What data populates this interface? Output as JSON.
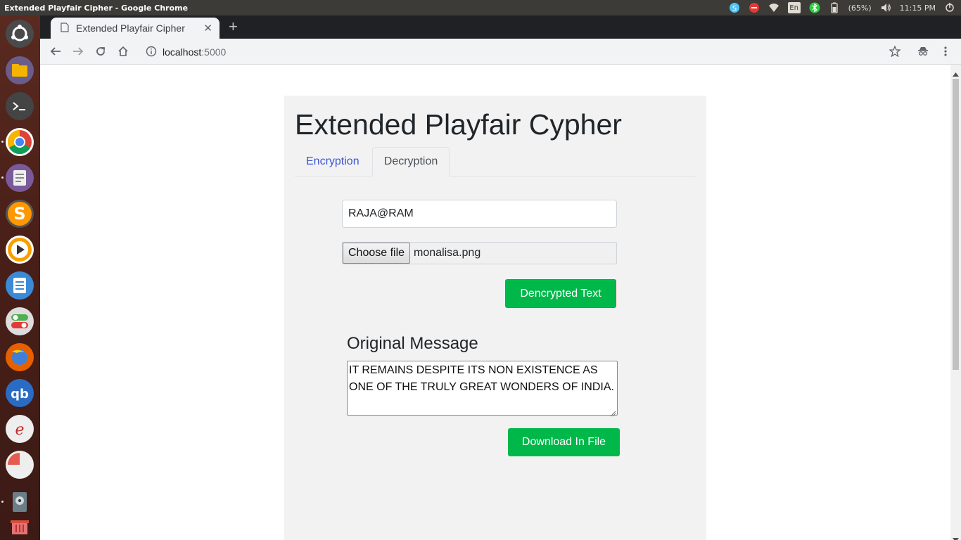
{
  "window": {
    "title": "Extended Playfair Cipher - Google Chrome"
  },
  "tray": {
    "keyboard": "En",
    "battery": "(65%)",
    "time": "11:15 PM"
  },
  "browser": {
    "tab_title": "Extended Playfair Cipher",
    "url_host": "localhost",
    "url_port": ":5000"
  },
  "page": {
    "heading": "Extended Playfair Cypher",
    "tabs": [
      {
        "label": "Encryption",
        "active": false
      },
      {
        "label": "Decryption",
        "active": true
      }
    ],
    "key_value": "RAJA@RAM",
    "file_button": "Choose file",
    "file_name": "monalisa.png",
    "decrypt_button": "Dencrypted Text",
    "original_label": "Original Message",
    "original_message": "IT REMAINS DESPITE ITS NON EXISTENCE AS ONE OF THE TRULY GREAT WONDERS OF INDIA.",
    "download_button": "Download In File"
  },
  "colors": {
    "primary_green": "#00b74a",
    "link_blue": "#3b56d6",
    "card_bg": "#f2f2f2"
  }
}
